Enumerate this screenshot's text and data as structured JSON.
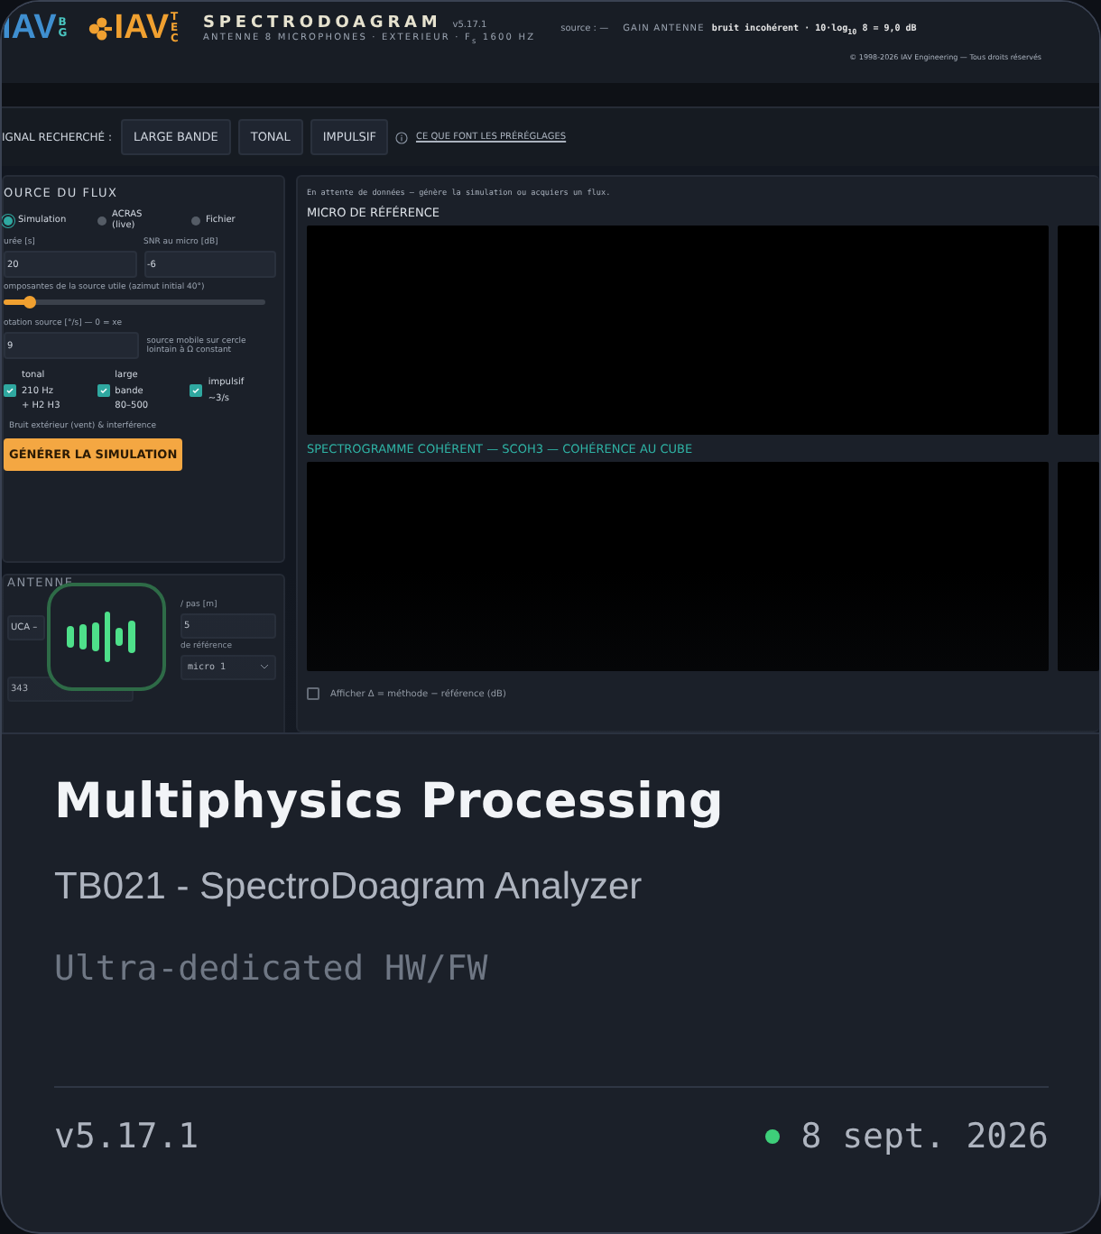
{
  "screenshot": {
    "header": {
      "logo_1": "IAV",
      "logo_1_tag": "BG",
      "logo_2": "IAV",
      "logo_2_tag": "TEC",
      "app_name": "SPECTRODOAGRAM",
      "version": "v5.17.1",
      "subtitle": "ANTENNE 8 MICROPHONES · EXTERIEUR · F$_{s}$ 1600 HZ",
      "source": "source : —",
      "gain_label": "GAIN ANTENNE",
      "gain_value": "bruit incohérent · 10·log$_{10}$ 8 = 9,0 dB",
      "copyright": "© 1998-2026 IAV Engineering — Tous droits réservés"
    },
    "presets": {
      "label": "IGNAL RECHERCHÉ :",
      "buttons": [
        {
          "label": "LARGE BANDE",
          "selected": false
        },
        {
          "label": "TONAL",
          "selected": false
        },
        {
          "label": "IMPULSIF",
          "selected": false
        }
      ],
      "info_link": "CE QUE FONT LES PRÉRÉGLAGES"
    },
    "source_panel": {
      "title": "OURCE DU FLUX",
      "radios": [
        {
          "label": "Simulation",
          "selected": true
        },
        {
          "label": "ACRAS (live)",
          "selected": false
        },
        {
          "label": "Fichier",
          "selected": false
        }
      ],
      "fields": [
        {
          "label": "urée [s]",
          "value": "20"
        },
        {
          "label": "SNR au micro [dB]",
          "value": "-6"
        }
      ],
      "slider": {
        "label": "omposantes de la source utile (azimut initial 40°)",
        "level": 0.1
      },
      "rotation": {
        "label": "otation source [°/s] — 0 = xe",
        "value": "9",
        "hint": "source mobile sur cercle lointain à Ω constant"
      },
      "checks": [
        {
          "label": "tonal 210 Hz + H2 H3",
          "checked": true
        },
        {
          "label": "large bande 80–500",
          "checked": true
        },
        {
          "label": "impulsif ~3/s",
          "checked": true
        }
      ],
      "noise_label": "Bruit extérieur (vent) & interférence",
      "generate_button": "GÉNÉRER LA SIMULATION"
    },
    "antenna_panel": {
      "title": "ANTENNE",
      "field_1": {
        "value": "UCA –"
      },
      "field_2": {
        "label": "/ pas [m]",
        "value": "5"
      },
      "field_3": {
        "value": "343"
      },
      "field_4": {
        "label": "de référence",
        "value": "micro 1"
      }
    },
    "display_panel": {
      "status": "En attente de données — génère la simulation ou acquiers un flux.",
      "plot_1_title": "MICRO DE RÉFÉRENCE",
      "plot_2_title": "SPECTROGRAMME COHÉRENT — SCOH3 — COHÉRENCE AU CUBE",
      "delta_option": {
        "label": "Afficher Δ = méthode − référence (dB)",
        "checked": false
      }
    }
  },
  "title": "Multiphysics Processing",
  "subtitle": "TB021 - SpectroDoagram Analyzer",
  "tagline": "Ultra-dedicated HW/FW",
  "version": "v5.17.1",
  "date": "8 sept. 2026"
}
